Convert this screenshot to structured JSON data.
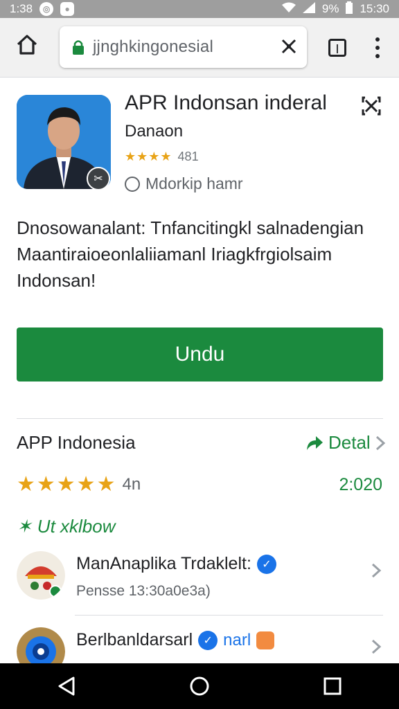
{
  "status_bar": {
    "time_left": "1:38",
    "battery": "9%",
    "time_right": "15:30"
  },
  "browser": {
    "url": "jjnghkingonesial"
  },
  "app": {
    "title": "APR Indonsan inderal",
    "developer": "Danaon",
    "rating_stars": 4,
    "rating_count": "481",
    "meta": "Mdorkip hamr",
    "description": "Dnosowanalant: Tnfancitingkl salnadengian Maantiraioeonlaliiamanl Iriagkfrgiolsaim Indonsan!",
    "install_label": "Undu"
  },
  "details": {
    "section_title": "APP Indonesia",
    "detail_link": "Detal",
    "stars": 4.5,
    "rating_text": "4n",
    "version": "2:020"
  },
  "related_label": "Ut xklbow",
  "list": [
    {
      "title": "ManAnaplika Trdaklelt:",
      "subtitle": "Pensse 13:30a0e3a)"
    },
    {
      "title": "Berlbanldarsarl",
      "tag": "narl"
    }
  ],
  "colors": {
    "accent_green": "#1b8a3e",
    "star": "#e8a317",
    "verified_blue": "#1a73e8"
  }
}
